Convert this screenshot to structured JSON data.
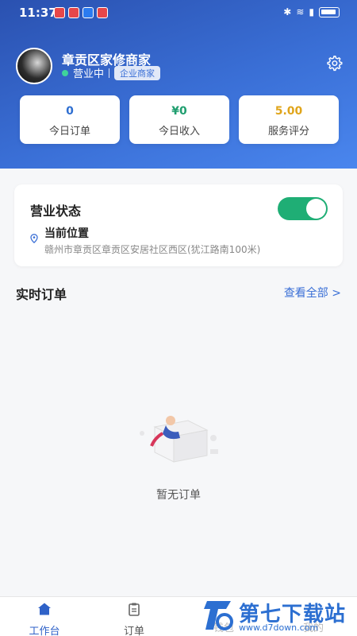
{
  "status_bar": {
    "time": "11:37"
  },
  "shop": {
    "name": "章贡区家修商家",
    "status": "营业中",
    "tag": "企业商家"
  },
  "stats": [
    {
      "value": "0",
      "label": "今日订单",
      "color": "#2f6fd1"
    },
    {
      "value": "¥0",
      "label": "今日收入",
      "color": "#1f9e6f"
    },
    {
      "value": "5.00",
      "label": "服务评分",
      "color": "#e0a51b"
    }
  ],
  "business": {
    "title": "营业状态",
    "toggle_on": true,
    "location_label": "当前位置",
    "address": "赣州市章贡区章贡区安居社区西区(犹江路南100米)"
  },
  "orders": {
    "title": "实时订单",
    "view_all": "查看全部 >",
    "empty_text": "暂无订单"
  },
  "tabbar": {
    "tabs": [
      {
        "label": "工作台"
      },
      {
        "label": "订单"
      },
      {
        "label": "钱包"
      },
      {
        "label": "我的"
      }
    ]
  },
  "watermark": {
    "text": "第七下载站",
    "url": "www.d7down.com"
  }
}
